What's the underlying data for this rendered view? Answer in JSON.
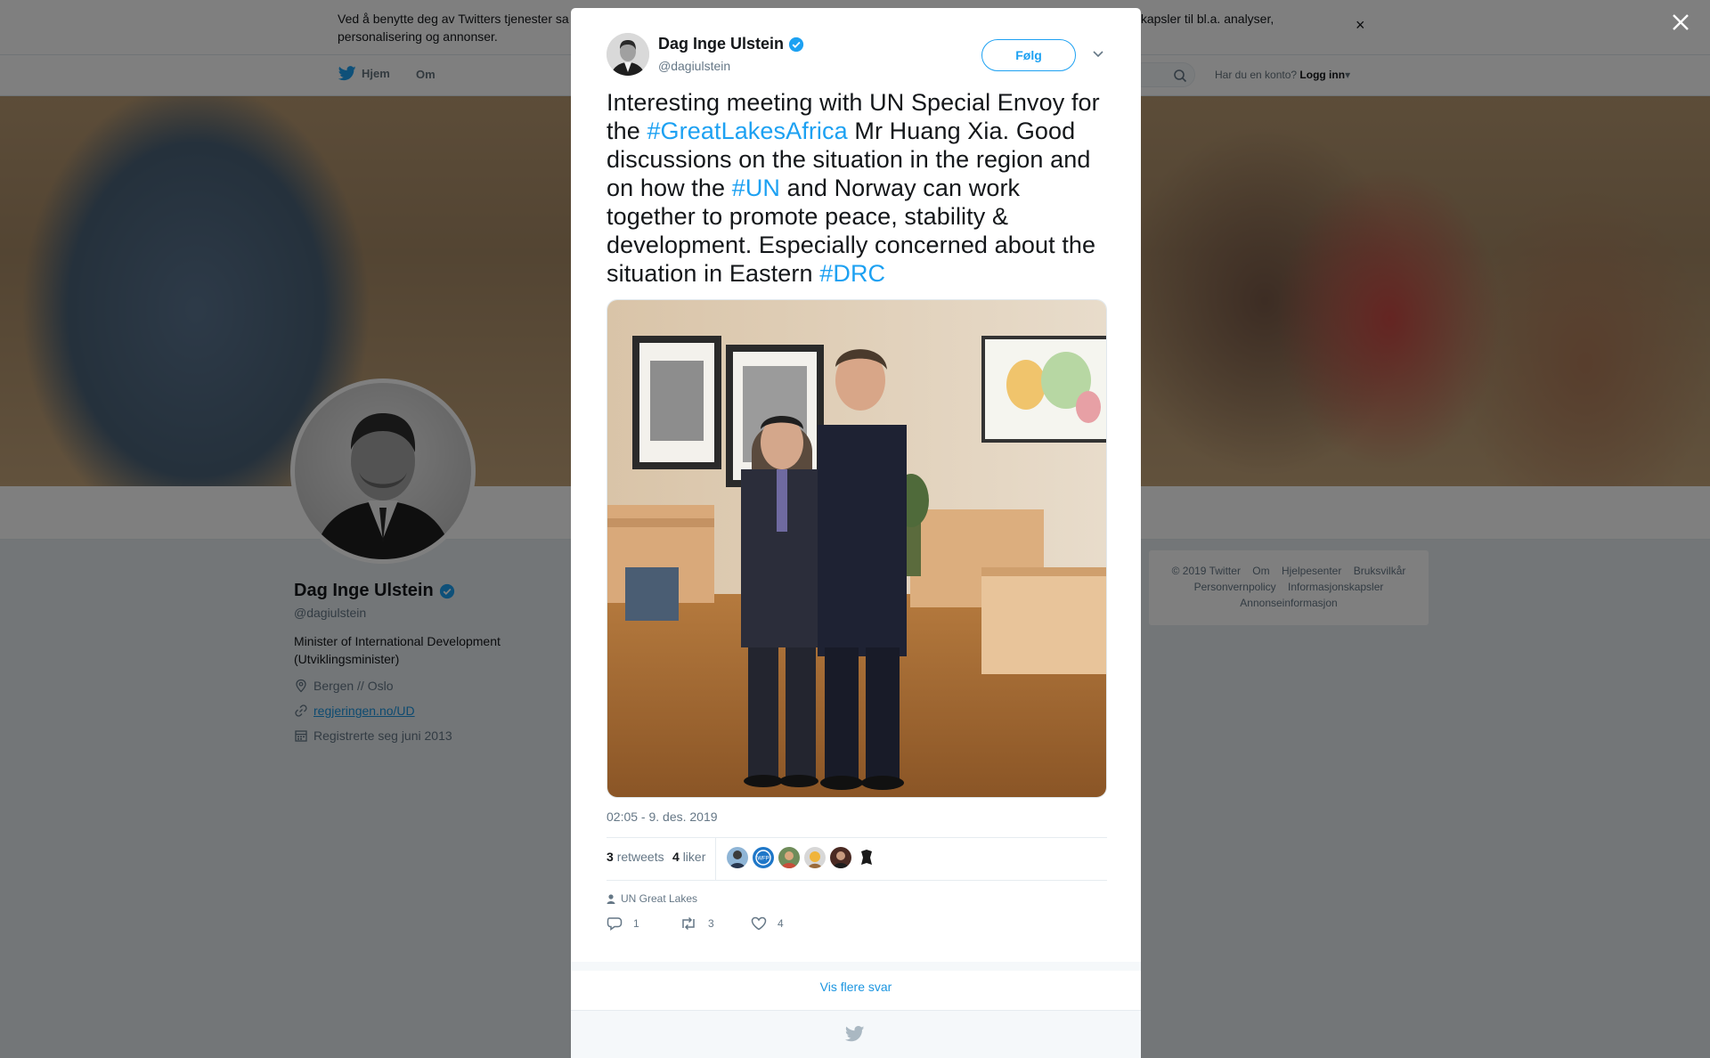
{
  "cookie_bar": {
    "text": "Ved å benytte deg av Twitters tjenester sa... informasjonskapsler til bl.a. analyser, personalisering og annonser.",
    "text_left": "Ved å benytte deg av Twitters tjenester sa",
    "text_right": "informasjonskapsler til bl.a. analyser,",
    "text_line2": "personalisering og annonser.",
    "close_glyph": "×"
  },
  "topnav": {
    "home_label": "Hjem",
    "about_label": "Om",
    "login_prompt": "Har du en konto?",
    "login_label": "Logg inn"
  },
  "profile": {
    "name": "Dag Inge Ulstein",
    "handle": "@dagiulstein",
    "bio": "Minister of International Development (Utviklingsminister)",
    "location": "Bergen // Oslo",
    "website": "regjeringen.no/UD",
    "joined": "Registrerte seg juni 2013"
  },
  "footer": {
    "links": [
      "© 2019 Twitter",
      "Om",
      "Hjelpesenter",
      "Bruksvilkår",
      "Personvernpolicy",
      "Informasjonskapsler",
      "Annonseinformasjon"
    ]
  },
  "tweet": {
    "author_name": "Dag Inge Ulstein",
    "author_handle": "@dagiulstein",
    "follow_label": "Følg",
    "text_parts": [
      {
        "t": "Interesting meeting with UN Special Envoy for the ",
        "tag": false
      },
      {
        "t": "#GreatLakesAfrica",
        "tag": true
      },
      {
        "t": " Mr Huang Xia. Good discussions on the situation in the region and on how the ",
        "tag": false
      },
      {
        "t": "#UN",
        "tag": true
      },
      {
        "t": " and Norway can work together to promote peace, stability & development. Especially concerned about the situation in Eastern ",
        "tag": false
      },
      {
        "t": "#DRC",
        "tag": true
      }
    ],
    "timestamp": "02:05 - 9. des. 2019",
    "retweets_count": "3",
    "retweets_label": "retweets",
    "likes_count": "4",
    "likes_label": "liker",
    "context_label": "UN Great Lakes",
    "reply_count": "1",
    "retweet_count": "3",
    "like_count": "4",
    "more_replies_label": "Vis flere svar"
  },
  "colors": {
    "accent": "#1da1f2",
    "link": "#1b95e0",
    "verified": "#1da1f2",
    "text": "#14171a",
    "muted": "#657786"
  }
}
